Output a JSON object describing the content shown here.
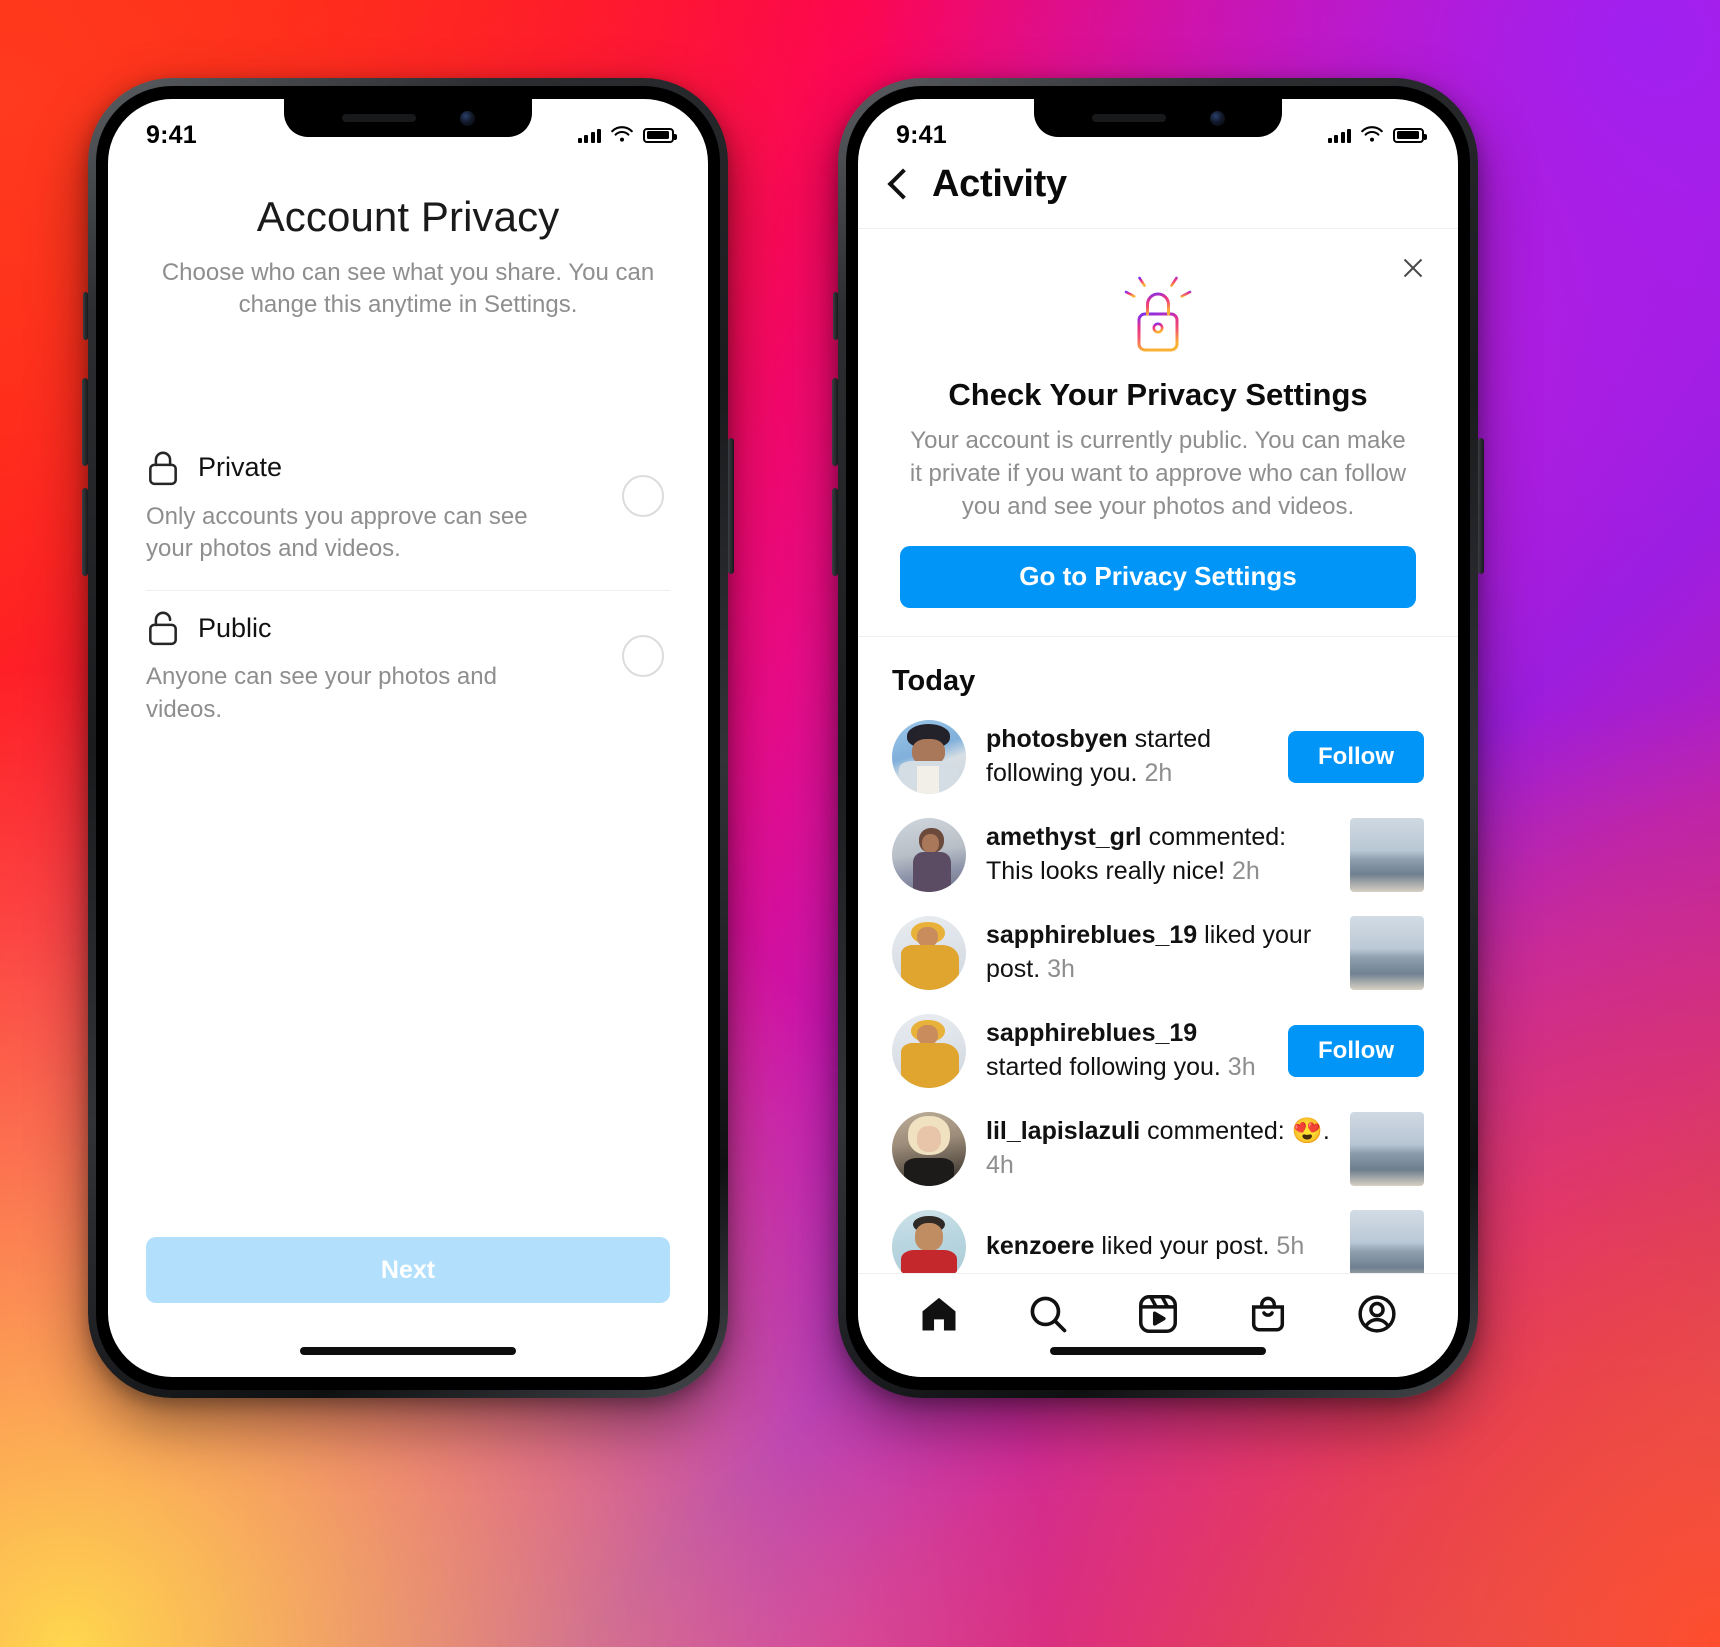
{
  "background": {
    "accent_pink": "#f30f6b",
    "accent_purple": "#8a25e8",
    "accent_orange": "#fc5130"
  },
  "left_phone": {
    "status": {
      "time": "9:41",
      "signal_icon": "cellular-bars-icon",
      "wifi_icon": "wifi-icon",
      "battery_icon": "battery-icon"
    },
    "screen": {
      "title": "Account Privacy",
      "subtitle": "Choose who can see what you share. You can change this anytime in Settings.",
      "options": [
        {
          "icon": "lock-closed-icon",
          "name": "Private",
          "description": "Only accounts you approve can see your photos and videos.",
          "selected": false
        },
        {
          "icon": "lock-open-icon",
          "name": "Public",
          "description": "Anyone can see your photos and videos.",
          "selected": false
        }
      ],
      "next_label": "Next",
      "next_enabled": false,
      "next_bg": "#b2dffc"
    }
  },
  "right_phone": {
    "status": {
      "time": "9:41",
      "signal_icon": "cellular-bars-icon",
      "wifi_icon": "wifi-icon",
      "battery_icon": "battery-icon"
    },
    "header": {
      "back_icon": "chevron-left-icon",
      "title": "Activity"
    },
    "privacy_card": {
      "close_icon": "close-icon",
      "art_icon": "lock-gradient-icon",
      "title": "Check Your Privacy Settings",
      "body": "Your account is currently public. You can make it private if you want to approve who can follow you and see your photos and videos.",
      "cta_label": "Go to Privacy Settings",
      "cta_color": "#0095f6"
    },
    "section_label": "Today",
    "follow_label": "Follow",
    "activity": [
      {
        "user": "photosbyen",
        "action": " started following you. ",
        "time": "2h",
        "trailing": "follow",
        "avatar_hint": "man-in-bucket-hat"
      },
      {
        "user": "amethyst_grl",
        "action": " commented: This looks really nice! ",
        "time": "2h",
        "trailing": "thumbnail",
        "avatar_hint": "woman-under-umbrella"
      },
      {
        "user": "sapphireblues_19",
        "action": " liked your post. ",
        "time": "3h",
        "trailing": "thumbnail",
        "avatar_hint": "woman-yellow-dress"
      },
      {
        "user": "sapphireblues_19",
        "action": " started following you. ",
        "time": "3h",
        "trailing": "follow",
        "avatar_hint": "woman-yellow-dress"
      },
      {
        "user": "lil_lapislazuli",
        "action": " commented: 😍. ",
        "time": "4h",
        "trailing": "thumbnail",
        "avatar_hint": "blonde-woman"
      },
      {
        "user": "kenzoere",
        "action": " liked your post. ",
        "time": "5h",
        "trailing": "thumbnail",
        "avatar_hint": "man-red-shirt"
      }
    ],
    "tabbar": [
      {
        "icon": "home-icon",
        "active": true
      },
      {
        "icon": "search-icon",
        "active": false
      },
      {
        "icon": "reels-icon",
        "active": false
      },
      {
        "icon": "shop-icon",
        "active": false
      },
      {
        "icon": "profile-icon",
        "active": false
      }
    ]
  }
}
